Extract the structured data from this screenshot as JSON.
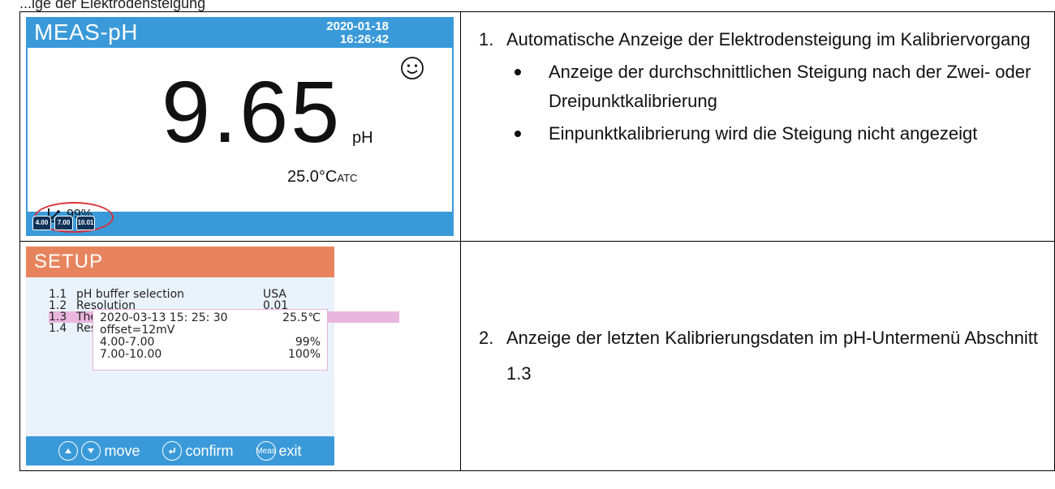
{
  "caption": "...ige der Elektrodensteigung",
  "row1": {
    "screen": {
      "mode": "MEAS-pH",
      "date": "2020-01-18",
      "time": "16:26:42",
      "reading": "9.65",
      "unit": "pH",
      "temp": "25.0°C",
      "temp_mode": "ATC",
      "slope": "99%",
      "buffers": [
        "4.00",
        "7.00",
        "10.01"
      ],
      "smiley_icon": "smiley-icon",
      "slope_icon": "slope-icon",
      "highlight_color": "#d9323a",
      "accent": "#3a9ad9"
    },
    "item_number": "1.",
    "item_text": "Automatische Anzeige der Elektrodensteigung im Kalibriervorgang",
    "bullets": [
      "Anzeige der durchschnittlichen Steigung nach der Zwei- oder Dreipunktkalibrierung",
      "Einpunktkalibrierung wird die Steigung nicht angezeigt"
    ]
  },
  "row2": {
    "screen": {
      "title": "SETUP",
      "header_color": "#e7845e",
      "rows": [
        {
          "num": "1.1",
          "label": "pH buffer selection",
          "value": "USA"
        },
        {
          "num": "1.2",
          "label": "Resolution",
          "value": "0.01"
        },
        {
          "num": "1.3",
          "label": "The",
          "value": ""
        },
        {
          "num": "1.4",
          "label": "Res",
          "value": ""
        }
      ],
      "popup": {
        "timestamp": "2020-03-13  15: 25: 30",
        "temp": "25.5℃",
        "offset": "offset=12mV",
        "slopes": [
          {
            "range": "4.00-7.00",
            "value": "99%"
          },
          {
            "range": "7.00-10.00",
            "value": "100%"
          }
        ]
      },
      "footer": {
        "move": "move",
        "confirm": "confirm",
        "meas_key": "Meas",
        "exit": "exit"
      }
    },
    "item_number": "2.",
    "item_text": "Anzeige der letzten Kalibrierungsdaten im pH-Untermenü Abschnitt 1.3"
  }
}
